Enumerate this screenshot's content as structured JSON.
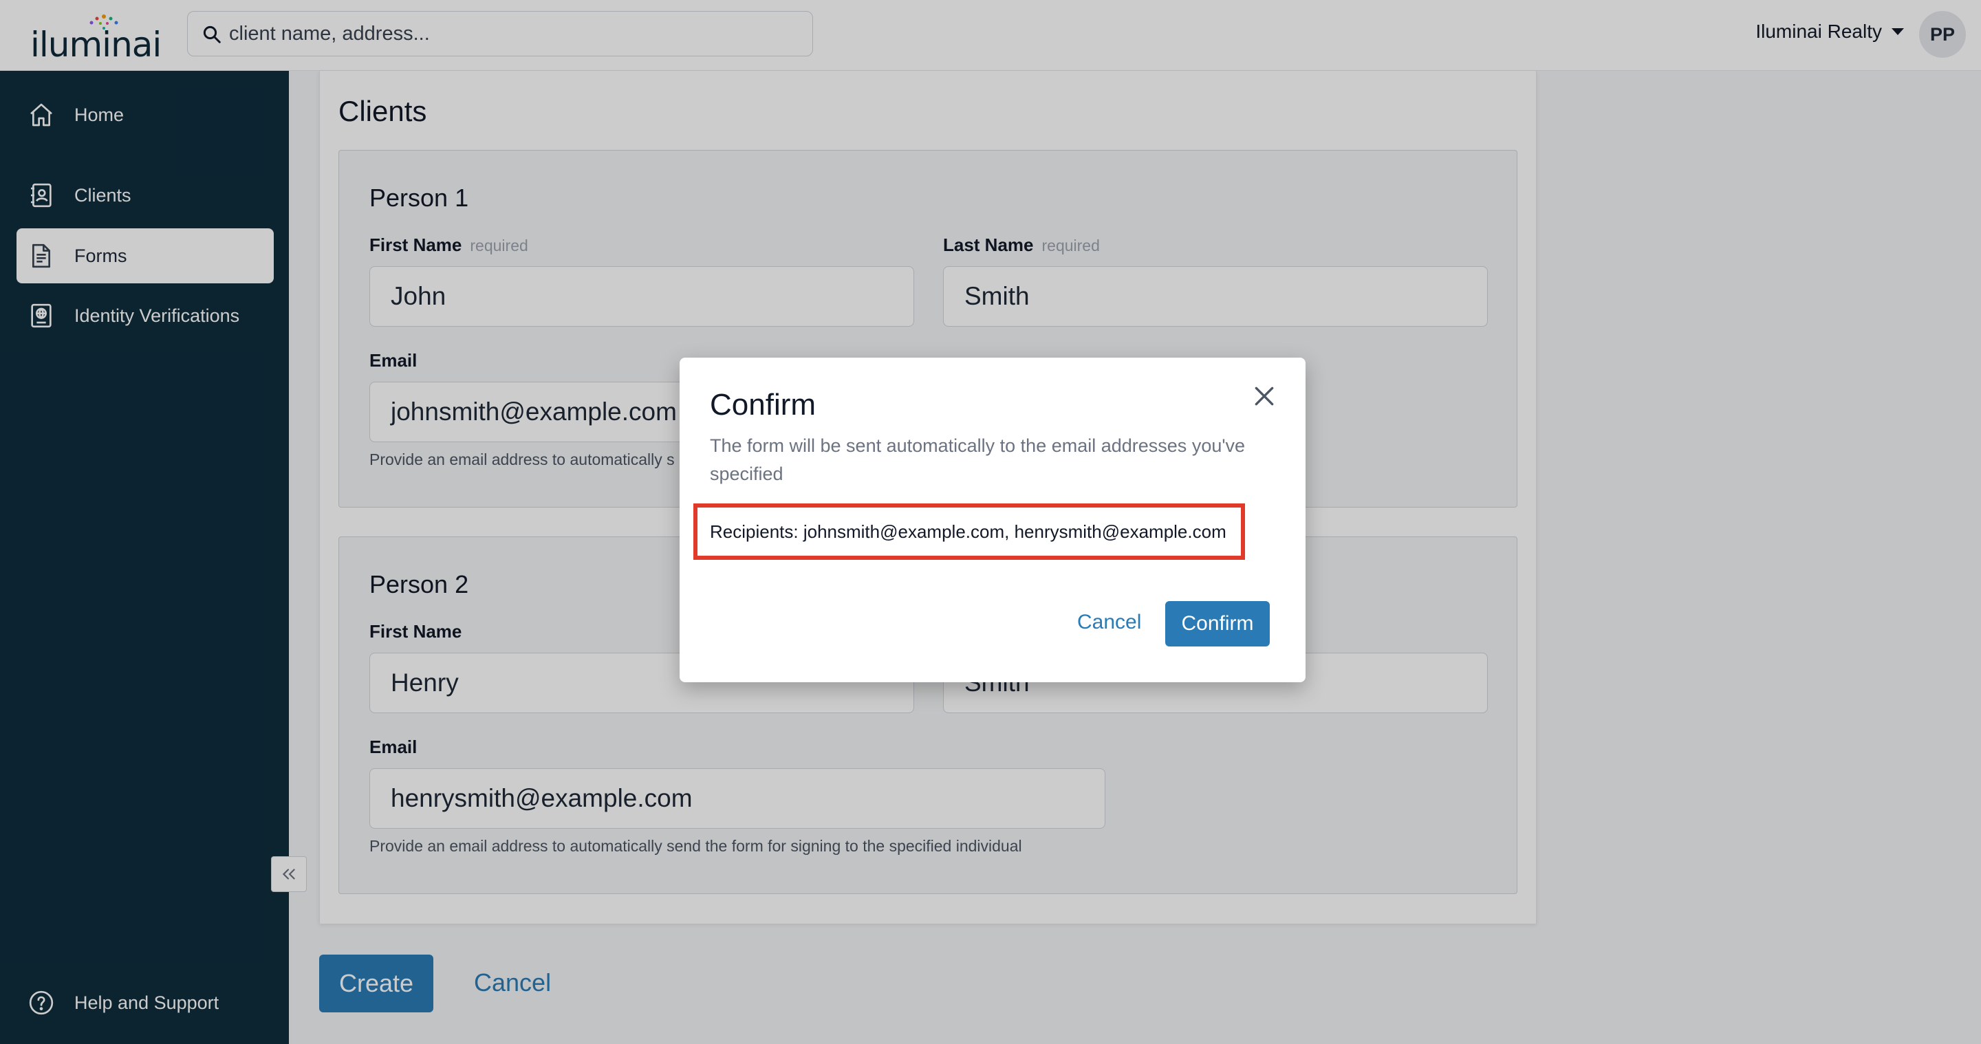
{
  "app": {
    "logo_text": "iluminai",
    "org_name": "Iluminai Realty",
    "avatar_initials": "PP"
  },
  "search": {
    "placeholder": "client name, address..."
  },
  "sidebar": {
    "items": [
      {
        "label": "Home",
        "icon": "home-icon"
      },
      {
        "label": "Clients",
        "icon": "contacts-icon"
      },
      {
        "label": "Forms",
        "icon": "document-icon",
        "active": true
      },
      {
        "label": "Identity Verifications",
        "icon": "id-globe-icon"
      }
    ],
    "help_label": "Help and Support"
  },
  "page": {
    "title": "Clients"
  },
  "persons": [
    {
      "title": "Person 1",
      "first_name_label": "First Name",
      "first_name_req": "required",
      "first_name_value": "John",
      "last_name_label": "Last Name",
      "last_name_req": "required",
      "last_name_value": "Smith",
      "email_label": "Email",
      "email_value": "johnsmith@example.com",
      "email_help": "Provide an email address to automatically s"
    },
    {
      "title": "Person 2",
      "first_name_label": "First Name",
      "first_name_value": "Henry",
      "last_name_value": "Smith",
      "email_label": "Email",
      "email_value": "henrysmith@example.com",
      "email_help": "Provide an email address to automatically send the form for signing to the specified individual"
    }
  ],
  "actions": {
    "create_label": "Create",
    "cancel_label": "Cancel"
  },
  "modal": {
    "title": "Confirm",
    "description": "The form will be sent automatically to the email addresses you've specified",
    "recipients": "Recipients: johnsmith@example.com, henrysmith@example.com",
    "cancel_label": "Cancel",
    "confirm_label": "Confirm",
    "highlight_color": "#e03a2a"
  },
  "colors": {
    "primary": "#2a7bb5",
    "sidebar": "#0f2d3d"
  }
}
